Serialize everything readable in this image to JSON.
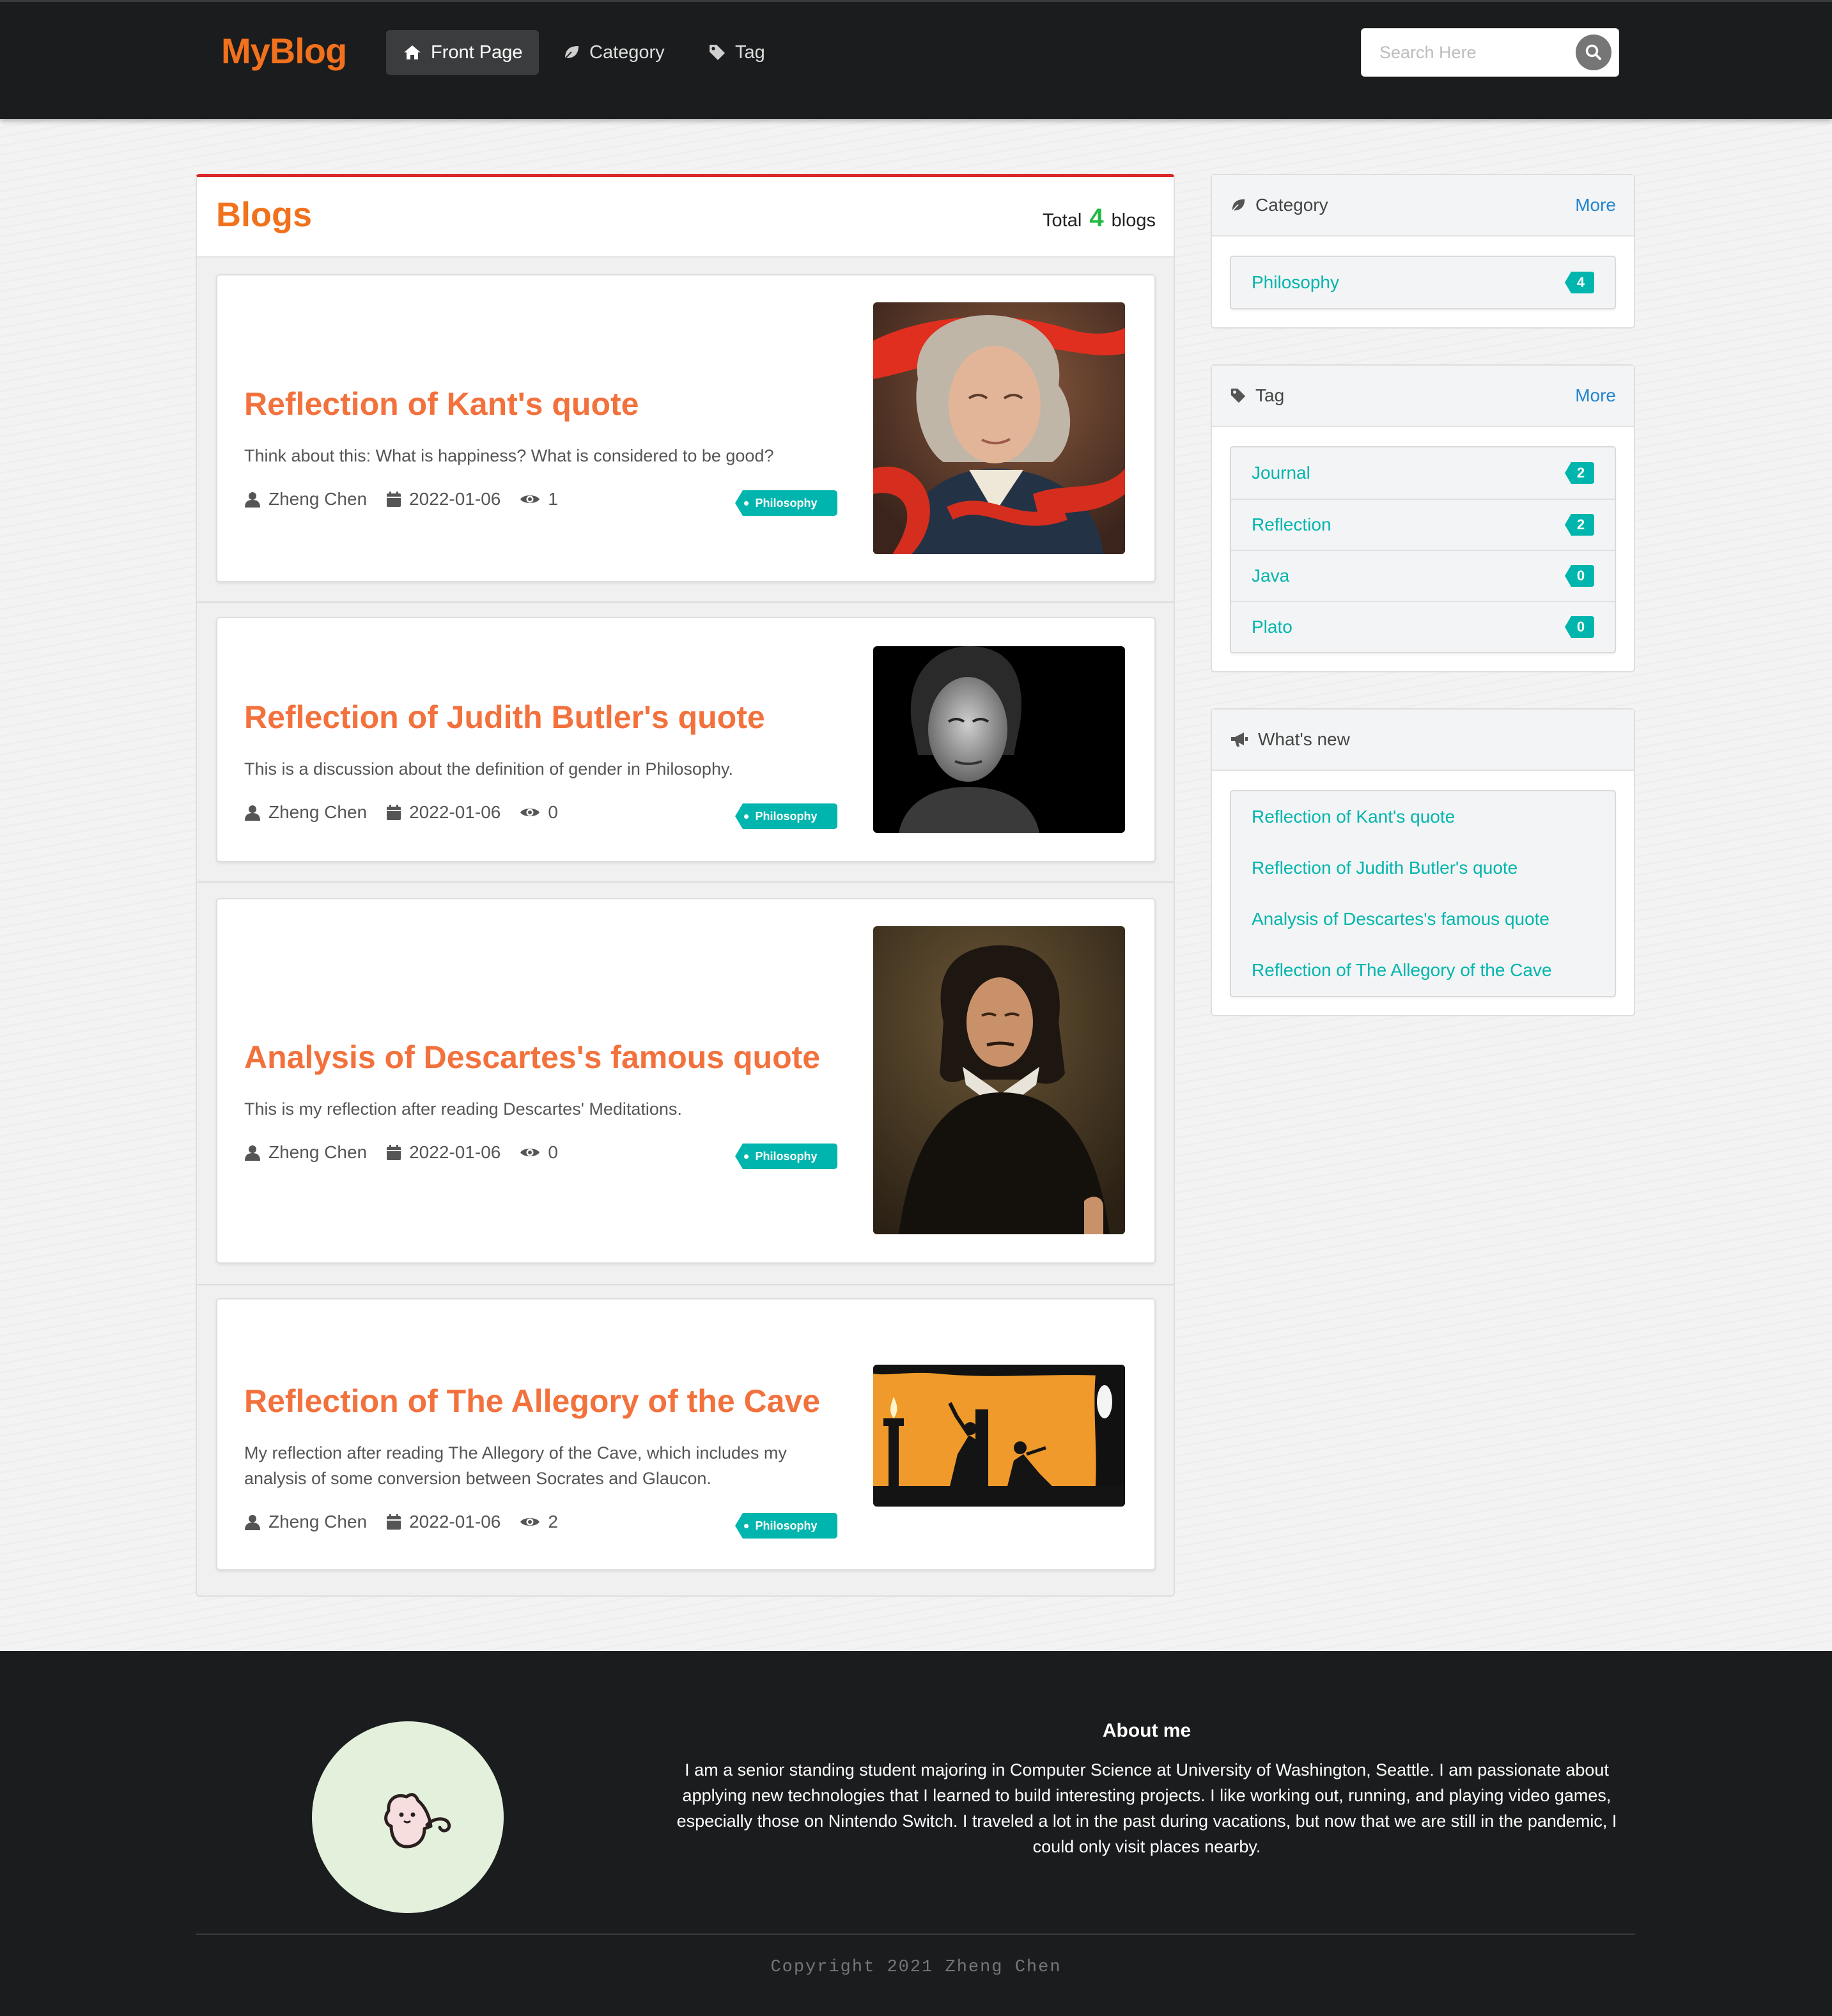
{
  "header": {
    "logo": "MyBlog",
    "nav": [
      {
        "label": "Front Page",
        "icon": "home-icon",
        "active": true
      },
      {
        "label": "Category",
        "icon": "leaf-icon",
        "active": false
      },
      {
        "label": "Tag",
        "icon": "tag-icon",
        "active": false
      }
    ],
    "search_placeholder": "Search Here"
  },
  "blogs": {
    "title": "Blogs",
    "total_prefix": "Total",
    "total_count": "4",
    "total_suffix": "blogs",
    "items": [
      {
        "title": "Reflection of Kant's quote",
        "description": "Think about this: What is happiness? What is considered to be good?",
        "author": "Zheng Chen",
        "date": "2022-01-06",
        "views": "1",
        "category": "Philosophy",
        "image": "portrait of Kant with red ribbon"
      },
      {
        "title": "Reflection of Judith Butler's quote",
        "description": "This is a discussion about the definition of gender in Philosophy.",
        "author": "Zheng Chen",
        "date": "2022-01-06",
        "views": "0",
        "category": "Philosophy",
        "image": "black and white portrait of Judith Butler"
      },
      {
        "title": "Analysis of Descartes's famous quote",
        "description": "This is my reflection after reading Descartes' Meditations.",
        "author": "Zheng Chen",
        "date": "2022-01-06",
        "views": "0",
        "category": "Philosophy",
        "image": "portrait of Descartes"
      },
      {
        "title": "Reflection of The Allegory of the Cave",
        "description": "My reflection after reading The Allegory of the Cave, which includes my analysis of some conversion between Socrates and Glaucon.",
        "author": "Zheng Chen",
        "date": "2022-01-06",
        "views": "2",
        "category": "Philosophy",
        "image": "orange illustration of the allegory of the cave"
      }
    ]
  },
  "sidebar": {
    "category": {
      "title": "Category",
      "more": "More",
      "items": [
        {
          "name": "Philosophy",
          "count": "4"
        }
      ]
    },
    "tag": {
      "title": "Tag",
      "more": "More",
      "items": [
        {
          "name": "Journal",
          "count": "2"
        },
        {
          "name": "Reflection",
          "count": "2"
        },
        {
          "name": "Java",
          "count": "0"
        },
        {
          "name": "Plato",
          "count": "0"
        }
      ]
    },
    "whats_new": {
      "title": "What's new",
      "items": [
        "Reflection of Kant's quote",
        "Reflection of Judith Butler's quote",
        "Analysis of Descartes's famous quote",
        "Reflection of The Allegory of the Cave"
      ]
    }
  },
  "footer": {
    "about_title": "About me",
    "about_text": "I am a senior standing student majoring in Computer Science at University of Washington, Seattle. I am passionate about applying new technologies that I learned to build interesting projects. I like working out, running, and playing video games, especially those on Nintendo Switch. I traveled a lot in the past during vacations, but now that we are still in the pandemic, I could only visit places nearby.",
    "copyright": "Copyright 2021 Zheng Chen"
  },
  "colors": {
    "brand_orange": "#f2711c",
    "title_orange": "#f2713c",
    "teal": "#00b5ad",
    "link_blue": "#2185d0",
    "count_green": "#21ba45",
    "accent_red": "#db2828",
    "dark_bg": "#1b1c1d"
  }
}
